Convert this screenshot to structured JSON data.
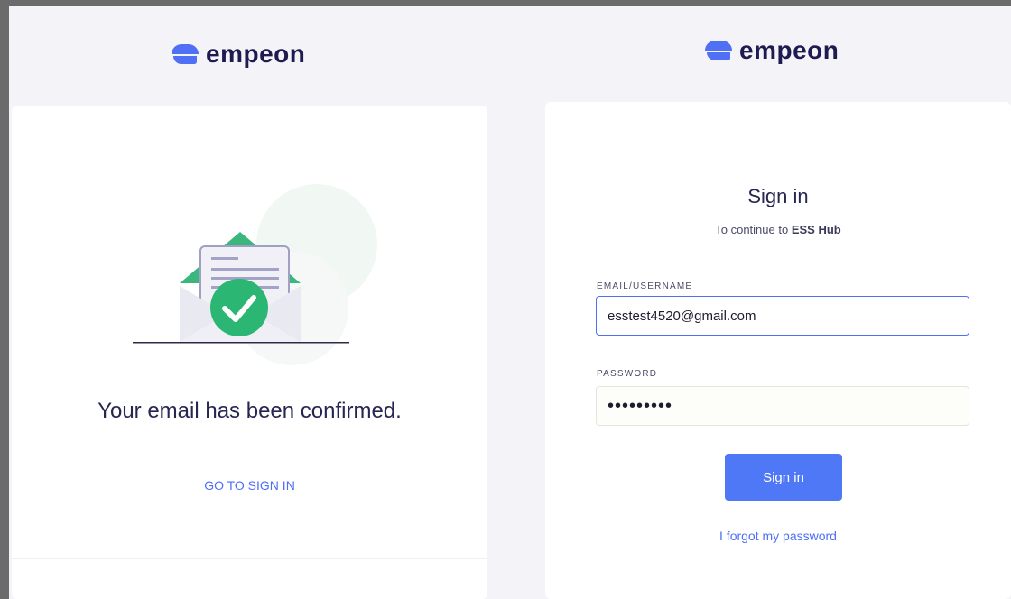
{
  "left": {
    "brand": "empeon",
    "confirmation_text": "Your email has been confirmed.",
    "go_to_signin": "GO TO SIGN IN"
  },
  "right": {
    "brand": "empeon",
    "title": "Sign in",
    "subtitle_prefix": "To continue to",
    "subtitle_app": "ESS Hub",
    "email_label": "EMAIL/USERNAME",
    "email_value": "esstest4520@gmail.com",
    "password_label": "PASSWORD",
    "password_mask": "•••••••••",
    "signin_button": "Sign in",
    "forgot_link": "I forgot my password"
  },
  "colors": {
    "brand_blue": "#4f6ff5",
    "navy_text": "#1d1b4f",
    "success_green": "#2bb673",
    "envelope_green": "#3bb77e"
  }
}
